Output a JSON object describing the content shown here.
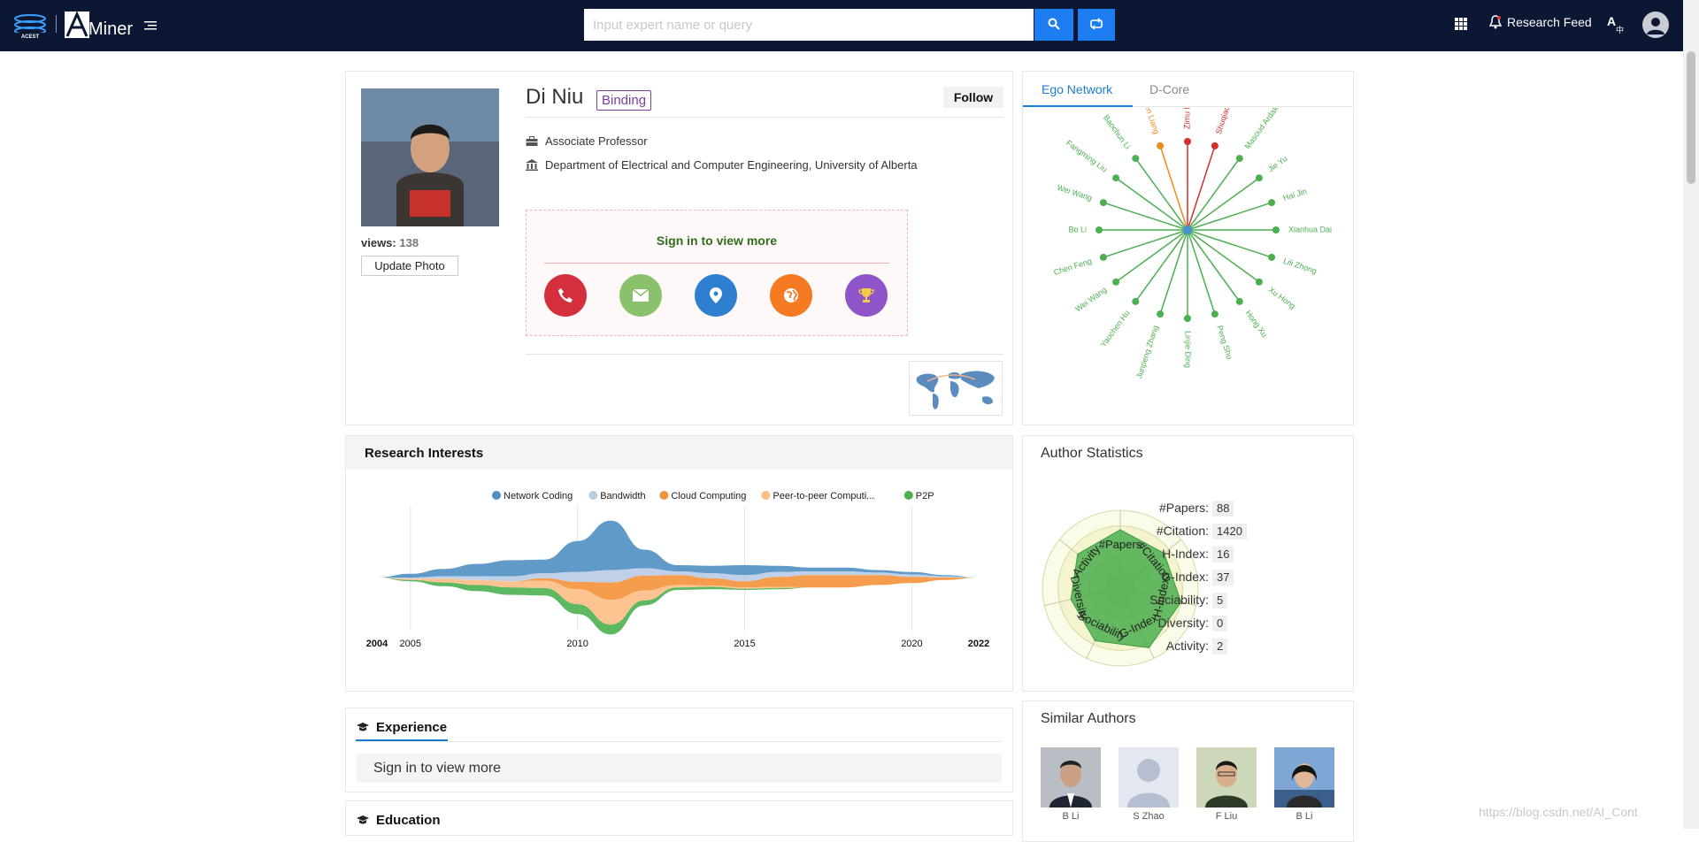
{
  "header": {
    "logo_text": "Miner",
    "search_placeholder": "Input expert name or query",
    "research_feed": "Research Feed",
    "lang_icon": "A中"
  },
  "profile": {
    "name": "Di Niu",
    "binding": "Binding",
    "follow": "Follow",
    "views_label": "views:",
    "views_count": "138",
    "update_photo": "Update Photo",
    "position": "Associate Professor",
    "affiliation": "Department of Electrical and Computer Engineering, University of Alberta",
    "signin_title": "Sign in to view more",
    "contact_icons": [
      "phone-icon",
      "email-icon",
      "location-icon",
      "globe-icon",
      "trophy-icon"
    ]
  },
  "ego_network": {
    "tabs": [
      "Ego Network",
      "D-Core"
    ],
    "nodes": [
      {
        "name": "Zimu Liu",
        "color": "#d32f2f"
      },
      {
        "name": "Shuqiao Zhao",
        "color": "#d32f2f"
      },
      {
        "name": "Masoud Ardakani",
        "color": "#4caf50"
      },
      {
        "name": "Jie Yu",
        "color": "#4caf50"
      },
      {
        "name": "Hai Jin",
        "color": "#4caf50"
      },
      {
        "name": "Xianhua Dai",
        "color": "#4caf50"
      },
      {
        "name": "Lili Zhong",
        "color": "#4caf50"
      },
      {
        "name": "Xu Hong",
        "color": "#4caf50"
      },
      {
        "name": "Hong Xu",
        "color": "#4caf50"
      },
      {
        "name": "Peng Shu",
        "color": "#4caf50"
      },
      {
        "name": "Linjie Ding",
        "color": "#4caf50"
      },
      {
        "name": "Junpeng Zhang",
        "color": "#4caf50"
      },
      {
        "name": "Yaochen Hu",
        "color": "#4caf50"
      },
      {
        "name": "Wei Wang",
        "color": "#4caf50"
      },
      {
        "name": "Chen Feng",
        "color": "#4caf50"
      },
      {
        "name": "Bo Li",
        "color": "#4caf50"
      },
      {
        "name": "Wei Wang",
        "color": "#4caf50"
      },
      {
        "name": "Fangming Liu",
        "color": "#4caf50"
      },
      {
        "name": "Baochun Li",
        "color": "#4caf50"
      },
      {
        "name": "Ben Liang",
        "color": "#ef8a17"
      }
    ]
  },
  "research_interests": {
    "title": "Research Interests",
    "chart_data": {
      "type": "area",
      "x": [
        2004,
        2005,
        2006,
        2007,
        2008,
        2009,
        2010,
        2011,
        2012,
        2013,
        2014,
        2015,
        2016,
        2017,
        2018,
        2019,
        2020,
        2021,
        2022
      ],
      "series": [
        {
          "name": "Network Coding",
          "color": "#4e8fc2",
          "values": [
            0,
            0.3,
            0.6,
            1.0,
            1.3,
            1.1,
            2.5,
            4.0,
            1.5,
            0.5,
            0.6,
            0.8,
            0.5,
            0.3,
            0.3,
            0.2,
            0.2,
            0.1,
            0
          ]
        },
        {
          "name": "Bandwidth",
          "color": "#b9cbe5",
          "values": [
            0,
            0.1,
            0.2,
            0.3,
            0.4,
            0.4,
            0.8,
            1.0,
            0.6,
            0.3,
            0.4,
            0.5,
            0.4,
            0.3,
            0.3,
            0.2,
            0.2,
            0.1,
            0
          ]
        },
        {
          "name": "Cloud Computing",
          "color": "#f4923a",
          "values": [
            0,
            0,
            0,
            0,
            0,
            0.2,
            0.6,
            1.4,
            1.2,
            0.8,
            0.6,
            0.5,
            0.8,
            1.0,
            1.0,
            0.8,
            0.5,
            0.2,
            0
          ]
        },
        {
          "name": "Peer-to-peer Computi...",
          "color": "#fdbe85",
          "values": [
            0,
            0.1,
            0.3,
            0.4,
            0.5,
            0.6,
            1.2,
            2.0,
            0.8,
            0.2,
            0.1,
            0.1,
            0.1,
            0,
            0,
            0,
            0,
            0,
            0
          ]
        },
        {
          "name": "P2P",
          "color": "#4caf50",
          "values": [
            0,
            0.1,
            0.3,
            0.5,
            0.6,
            0.6,
            0.8,
            0.8,
            0.4,
            0.2,
            0.2,
            0.1,
            0.1,
            0,
            0,
            0,
            0,
            0,
            0
          ]
        }
      ],
      "x_ticks": [
        "2004",
        "2005",
        "2010",
        "2015",
        "2020",
        "2022"
      ]
    }
  },
  "author_statistics": {
    "title": "Author Statistics",
    "chart_data": {
      "type": "radar",
      "axes": [
        "#Papers",
        "#Citation",
        "H-Index",
        "G-Index",
        "Sociability",
        "Diversity",
        "Activity"
      ],
      "values": [
        0.75,
        0.72,
        0.8,
        0.85,
        0.75,
        0.65,
        0.7
      ]
    },
    "stats": [
      {
        "label": "#Papers:",
        "value": "88"
      },
      {
        "label": "#Citation:",
        "value": "1420"
      },
      {
        "label": "H-Index:",
        "value": "16"
      },
      {
        "label": "G-Index:",
        "value": "37"
      },
      {
        "label": "Sociability:",
        "value": "5"
      },
      {
        "label": "Diversity:",
        "value": "0"
      },
      {
        "label": "Activity:",
        "value": "2"
      }
    ]
  },
  "experience": {
    "title": "Experience",
    "signin": "Sign in to view more"
  },
  "education": {
    "title": "Education"
  },
  "similar_authors": {
    "title": "Similar Authors",
    "authors": [
      {
        "name": "B Li"
      },
      {
        "name": "S Zhao"
      },
      {
        "name": "F Liu"
      },
      {
        "name": "B Li"
      }
    ]
  },
  "watermark": "https://blog.csdn.net/AI_Cont"
}
